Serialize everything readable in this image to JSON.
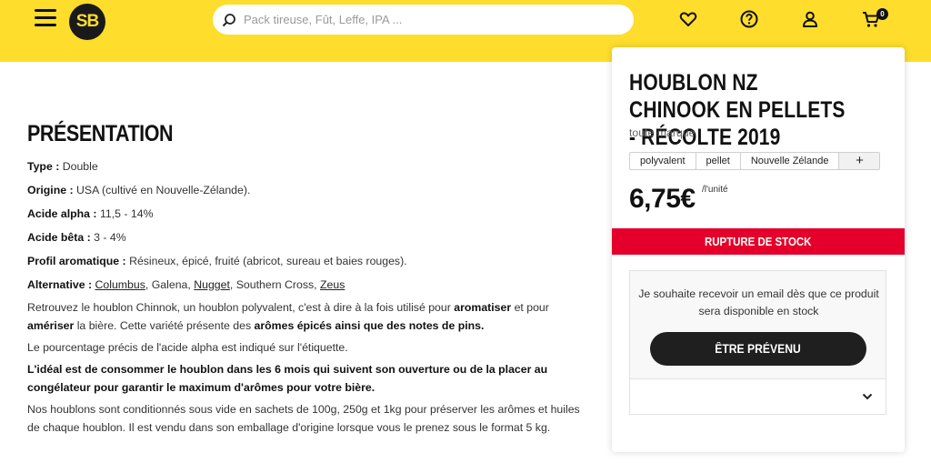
{
  "header": {
    "logo_text": "SB",
    "search_placeholder": "Pack tireuse, Fût, Leffe, IPA ...",
    "cart_count": "0",
    "colors": {
      "brand_yellow": "#fedd2c",
      "dark": "#1a1a1a"
    },
    "icons": [
      "menu-icon",
      "search-icon",
      "heart-icon",
      "help-icon",
      "user-icon",
      "cart-icon"
    ]
  },
  "presentation": {
    "title": "PRÉSENTATION",
    "type_label": "Type :",
    "type_value": "Double",
    "origin_label": "Origine :",
    "origin_value": "USA (cultivé en Nouvelle-Zélande).",
    "alpha_label": "Acide alpha :",
    "alpha_value": "11,5 - 14%",
    "beta_label": "Acide bêta :",
    "beta_value": "3 - 4%",
    "aroma_label": "Profil aromatique :",
    "aroma_value": "Résineux, épicé, fruité (abricot, sureau et baies rouges).",
    "alt_label": "Alternative :",
    "alt_links": [
      "Columbus",
      "Galena",
      "Nugget",
      "Southern Cross",
      "Zeus"
    ],
    "p1_a": "Retrouvez le houblon Chinnok, un houblon polyvalent, c'est à dire à la fois utilisé pour",
    "p1_b": "aromatiser",
    "p1_c": "et pour",
    "p1_d": "amériser",
    "p1_e": "la bière. Cette variété présente des",
    "p1_f": "arômes épicés ainsi que des notes de pins.",
    "p2": "Le pourcentage précis de l'acide alpha est indiqué sur l'étiquette.",
    "p3": "L'idéal est de consommer le houblon dans les 6 mois qui suivent son ouverture ou de la placer au congélateur pour garantir le maximum d'arômes pour votre bière.",
    "p4": "Nos houblons sont conditionnés sous vide en sachets de 100g, 250g et 1kg pour préserver les arômes et huiles de chaque houblon. Il est vendu dans son emballage d'origine lorsque vous le prenez sous le format 5 kg."
  },
  "product": {
    "title": "HOUBLON NZ CHINOOK EN PELLETS - RÉCOLTE 2019",
    "brand": "toute marque",
    "tags": [
      "polyvalent",
      "pellet",
      "Nouvelle Zélande"
    ],
    "tag_add": "+",
    "price": "6,75€",
    "unit": "/l'unité",
    "stock_status": "RUPTURE DE STOCK",
    "stock_color": "#e4002b",
    "notify_text": "Je souhaite recevoir un email dès que ce produit sera disponible en stock",
    "notify_button": "ÊTRE PRÉVENU"
  }
}
